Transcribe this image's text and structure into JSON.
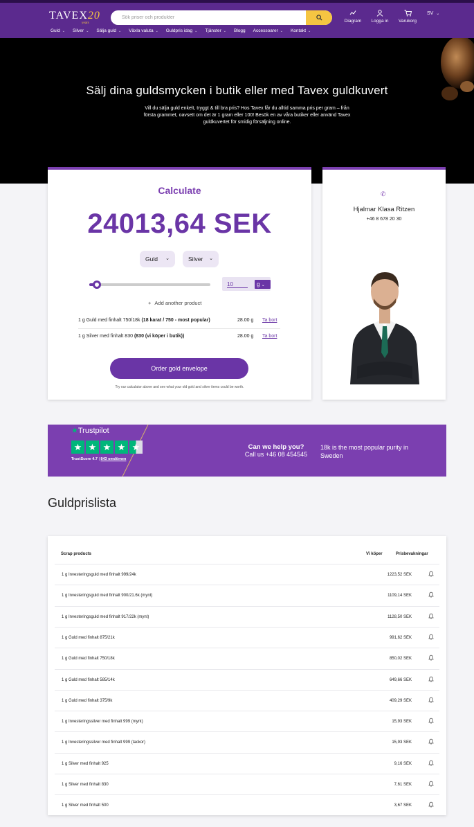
{
  "header": {
    "logo_text": "TAVEX",
    "logo_number": "20",
    "logo_sub": "years",
    "search_placeholder": "Sök priser och produkter",
    "icons": [
      {
        "name": "chart-icon",
        "label": "Diagram"
      },
      {
        "name": "user-icon",
        "label": "Logga in"
      },
      {
        "name": "cart-icon",
        "label": "Varukorg"
      }
    ],
    "language": "SV"
  },
  "nav": {
    "items": [
      {
        "label": "Guld"
      },
      {
        "label": "Silver"
      },
      {
        "label": "Sälja guld"
      },
      {
        "label": "Växla valuta"
      },
      {
        "label": "Guldpris idag"
      },
      {
        "label": "Tjänster"
      },
      {
        "label": "Blogg"
      },
      {
        "label": "Accessoarer"
      },
      {
        "label": "Kontakt"
      }
    ]
  },
  "hero": {
    "title": "Sälj dina guldsmycken i butik eller med Tavex guldkuvert",
    "text": "Vill du sälja guld enkelt, tryggt & till bra pris? Hos Tavex får du alltid samma pris per gram – från första grammet, oavsett om det är 1 gram eller 100! Besök en av våra butiker eller använd Tavex guldkuvertet för smidig försäljning online."
  },
  "calculator": {
    "title": "Calculate",
    "amount": "24013,64 SEK",
    "metal_select": "Guld",
    "metal_select_2": "Silver",
    "slider_fraction": 0.06,
    "grams_value": "10",
    "grams_unit": "g",
    "add_product": "Add another product",
    "products": [
      {
        "name": "1 g Guld med finhalt 750/18k",
        "detail": "(18 karat / 750 - most popular)",
        "qty": "28.00 g",
        "remove": "Ta bort"
      },
      {
        "name": "1 g Silver med finhalt 830",
        "detail": "(830 (vi köper i butik))",
        "qty": "28.00 g",
        "remove": "Ta bort"
      }
    ],
    "order_button": "Order gold envelope",
    "note": "Try our calculator above and see what your old gold and silver items could be worth."
  },
  "contact": {
    "name": "Hjalmar Klasa Ritzen",
    "phone": "+46 8 678 20 30"
  },
  "trustpilot": {
    "label": "Trustpilot",
    "score_text": "TrustScore 4.7",
    "reviews": "843 omdömen",
    "help_title": "Can we help you?",
    "help_phone": "Call us +46 08 454545",
    "purity_text": "18k is the most popular purity in Sweden"
  },
  "price_list": {
    "title": "Guldprislista",
    "headers": [
      "Scrap products",
      "Vi köper",
      "Prisbevakningar"
    ],
    "rows": [
      {
        "name": "1 g Investeringsguld med finhalt 999/24k",
        "price": "1223,52 SEK"
      },
      {
        "name": "1 g Investeringsguld med finhalt 900/21.6k (mynt)",
        "price": "1109,14 SEK"
      },
      {
        "name": "1 g Investeringsguld med finhalt 917/22k (mynt)",
        "price": "1128,50 SEK"
      },
      {
        "name": "1 g Guld med finhalt 875/21k",
        "price": "991,62 SEK"
      },
      {
        "name": "1 g Guld med finhalt 750/18k",
        "price": "850,02 SEK"
      },
      {
        "name": "1 g Guld med finhalt 585/14k",
        "price": "649,66 SEK"
      },
      {
        "name": "1 g Guld med finhalt 375/9k",
        "price": "409,29 SEK"
      },
      {
        "name": "1 g Investeringssilver med finhalt 999 (mynt)",
        "price": "15,93 SEK"
      },
      {
        "name": "1 g Investeringssilver med finhalt 999 (tackor)",
        "price": "15,93 SEK"
      },
      {
        "name": "1 g Silver med finhalt 925",
        "price": "9,16 SEK"
      },
      {
        "name": "1 g Silver med finhalt 830",
        "price": "7,61 SEK"
      },
      {
        "name": "1 g Silver med finhalt 500",
        "price": "3,67 SEK"
      }
    ]
  },
  "colors": {
    "brand_purple": "#6a35a6",
    "header_purple": "#5b2a8e",
    "gold": "#f5c542",
    "trustpilot_green": "#00b67a"
  }
}
